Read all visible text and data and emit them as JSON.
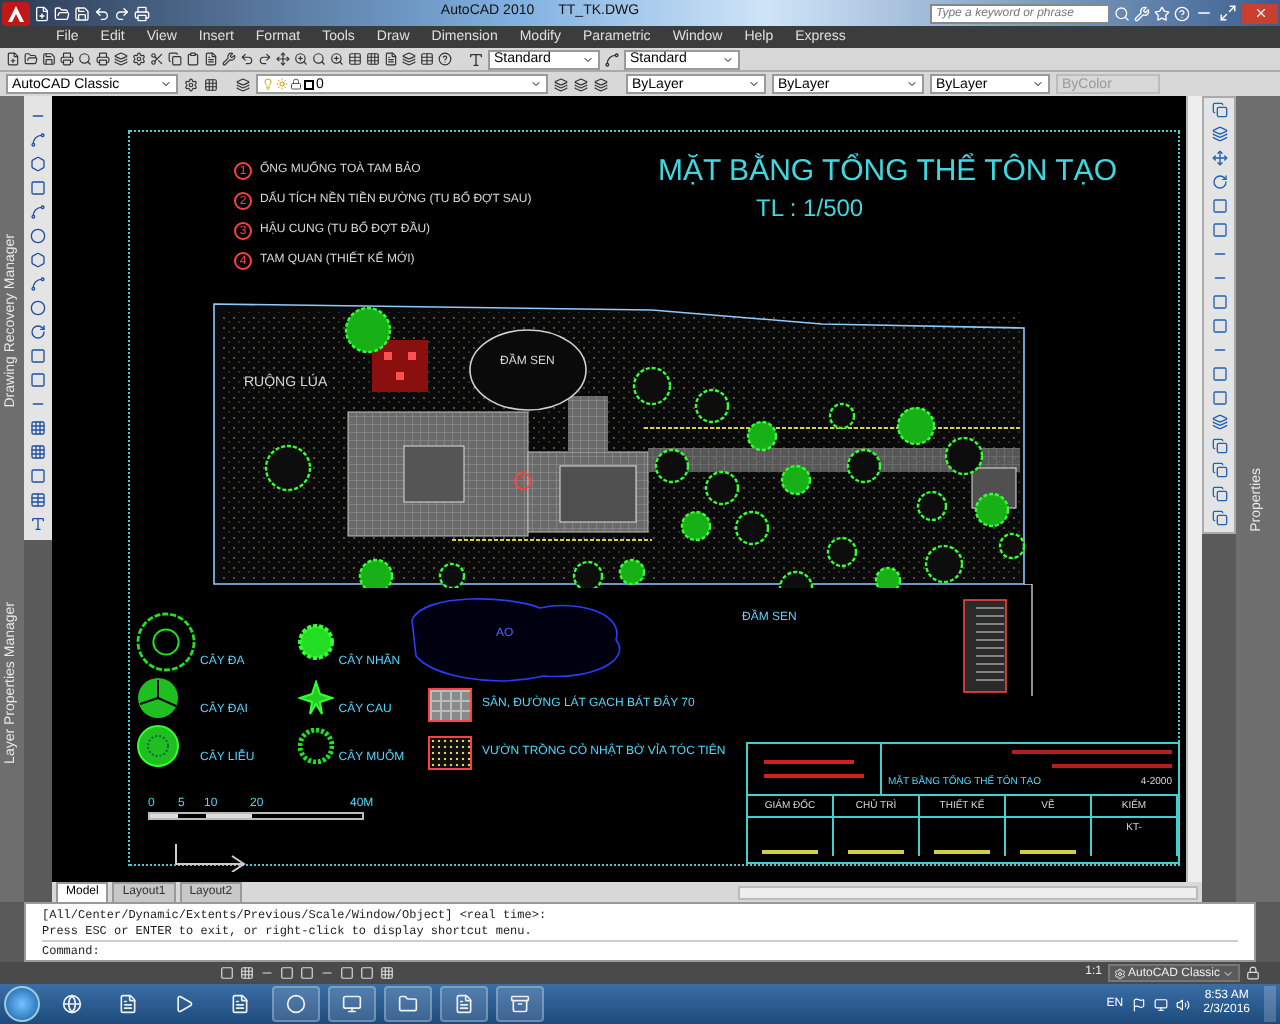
{
  "title_bar": {
    "app": "AutoCAD 2010",
    "file": "TT_TK.DWG",
    "search": {
      "placeholder": "Type a keyword or phrase"
    }
  },
  "menu": [
    "File",
    "Edit",
    "View",
    "Insert",
    "Format",
    "Tools",
    "Draw",
    "Dimension",
    "Modify",
    "Parametric",
    "Window",
    "Help",
    "Express"
  ],
  "toolbar": {
    "text_style": "Standard",
    "dim_style": "Standard"
  },
  "properties_bar": {
    "workspace": "AutoCAD Classic",
    "layer": "0",
    "color_setting": "ByLayer",
    "linetype": "ByLayer",
    "lineweight": "ByLayer",
    "plot_style": "ByColor"
  },
  "palettes": {
    "left": [
      "Drawing Recovery Manager",
      "Layer Properties Manager"
    ],
    "right": [
      "Properties"
    ]
  },
  "drawing": {
    "legend": [
      {
        "number": "1",
        "text": "ỐNG MUỐNG TOÀ TAM BẢO"
      },
      {
        "number": "2",
        "text": "DẤU TÍCH NỀN TIỀN ĐƯỜNG (TU BỔ ĐỢT SAU)"
      },
      {
        "number": "3",
        "text": "HẬU CUNG (TU BỔ ĐỢT ĐẦU)"
      },
      {
        "number": "4",
        "text": "TAM QUAN (THIẾT KẾ MỚI)"
      }
    ],
    "title": "MẶT BẰNG TỔNG THỂ TÔN TẠO",
    "scale": "TL : 1/500",
    "site_labels": [
      {
        "kind": "field",
        "text": "RUỘNG LÚA"
      },
      {
        "kind": "pond",
        "text": "ĐẦM SEN"
      },
      {
        "kind": "marker",
        "text": "1"
      },
      {
        "kind": "lake",
        "text": "AO"
      },
      {
        "kind": "pond_outer",
        "text": "ĐẦM SEN"
      }
    ],
    "trees": [
      {
        "kind": "banyan",
        "name": "CÂY ĐA"
      },
      {
        "kind": "frangipani",
        "name": "CÂY ĐẠI"
      },
      {
        "kind": "willow",
        "name": "CÂY LIỄU"
      },
      {
        "kind": "longan",
        "name": "CÂY NHÃN"
      },
      {
        "kind": "palm",
        "name": "CÂY CAU"
      },
      {
        "kind": "mango",
        "name": "CÂY MUỖM"
      }
    ],
    "materials": [
      {
        "kind": "paving",
        "text": "SÂN, ĐƯỜNG LÁT GẠCH BÁT ĐÂY 70"
      },
      {
        "kind": "lawn",
        "text": "VƯỜN TRỒNG CỎ NHẬT BỜ VỈA TÓC TIÊN"
      }
    ],
    "scale_bar": [
      "0",
      "5",
      "10",
      "20",
      "40M"
    ],
    "title_block": {
      "sheet_title": "MẶT BẰNG TỔNG THỂ TÔN TẠO",
      "roles": [
        "GIÁM ĐỐC",
        "CHỦ TRÌ",
        "THIẾT KẾ",
        "VẼ",
        "KIỂM"
      ],
      "code": "4-2000",
      "sheet_no": "KT-"
    }
  },
  "layout_tabs": [
    {
      "label": "Model",
      "selected": true
    },
    {
      "label": "Layout1",
      "selected": false
    },
    {
      "label": "Layout2",
      "selected": false
    }
  ],
  "command_lines": [
    "[All/Center/Dynamic/Extents/Previous/Scale/Window/Object] <real time>:",
    "Press ESC or ENTER to exit, or right-click to display shortcut menu."
  ],
  "command_prompt": "Command:",
  "status_bar": {
    "scale": "1:1",
    "workspace": "AutoCAD Classic"
  },
  "taskbar": {
    "language": "EN",
    "time": "8:53 AM",
    "date": "2/3/2016"
  }
}
